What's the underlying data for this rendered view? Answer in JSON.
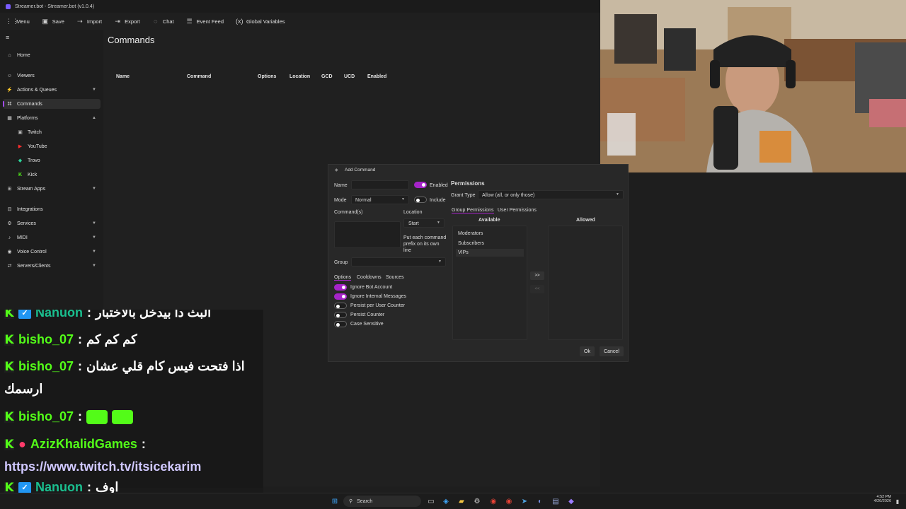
{
  "window": {
    "title": "Streamer.bot - Streamer.bot (v1.0.4)"
  },
  "toolbar": {
    "items": [
      {
        "label": "Menu",
        "icon": "grid-icon"
      },
      {
        "label": "Save",
        "icon": "save-icon"
      },
      {
        "label": "Import",
        "icon": "import-icon"
      },
      {
        "label": "Export",
        "icon": "export-icon"
      },
      {
        "label": "Chat",
        "icon": "chat-icon"
      },
      {
        "label": "Event Feed",
        "icon": "feed-icon"
      },
      {
        "label": "Global Variables",
        "icon": "variables-icon"
      }
    ]
  },
  "sidebar": {
    "items": [
      {
        "label": "Home",
        "icon": "home-icon"
      },
      {
        "label": "Viewers",
        "icon": "viewers-icon"
      },
      {
        "label": "Actions & Queues",
        "icon": "actions-icon",
        "expandable": true
      },
      {
        "label": "Commands",
        "icon": "commands-icon",
        "selected": true
      },
      {
        "label": "Platforms",
        "icon": "platforms-icon",
        "expanded": true
      },
      {
        "label": "Twitch",
        "icon": "twitch-icon",
        "sub": true
      },
      {
        "label": "YouTube",
        "icon": "youtube-icon",
        "sub": true
      },
      {
        "label": "Trovo",
        "icon": "trovo-icon",
        "sub": true
      },
      {
        "label": "Kick",
        "icon": "kick-icon",
        "sub": true
      },
      {
        "label": "Stream Apps",
        "icon": "stream-apps-icon",
        "expandable": true
      },
      {
        "label": "Integrations",
        "icon": "integrations-icon"
      },
      {
        "label": "Services",
        "icon": "services-icon",
        "expandable": true
      },
      {
        "label": "MIDI",
        "icon": "midi-icon",
        "expandable": true
      },
      {
        "label": "Voice Control",
        "icon": "voice-icon",
        "expandable": true
      },
      {
        "label": "Servers/Clients",
        "icon": "servers-icon",
        "expandable": true
      }
    ]
  },
  "main": {
    "title": "Commands",
    "columns": [
      "Name",
      "Command",
      "Options",
      "Location",
      "GCD",
      "UCD",
      "Enabled"
    ]
  },
  "dialog": {
    "title": "Add Command",
    "name_label": "Name",
    "name_value": "",
    "enabled_label": "Enabled",
    "enabled": true,
    "mode_label": "Mode",
    "mode_value": "Normal",
    "include_label": "Include",
    "include": false,
    "commands_label": "Command(s)",
    "commands_value": "",
    "location_label": "Location",
    "location_value": "Start",
    "location_hint": [
      "Put each command",
      "prefix on its own",
      "line"
    ],
    "group_label": "Group",
    "group_value": "",
    "tabs": [
      "Options",
      "Cooldowns",
      "Sources"
    ],
    "options": [
      {
        "label": "Ignore Bot Account",
        "on": true
      },
      {
        "label": "Ignore Internal Messages",
        "on": true
      },
      {
        "label": "Persist per User Counter",
        "on": false
      },
      {
        "label": "Persist Counter",
        "on": false
      },
      {
        "label": "Case Sensitive",
        "on": false
      }
    ],
    "permissions_title": "Permissions",
    "grant_type_label": "Grant Type",
    "grant_type_value": "Allow (all, or only those)",
    "perm_tabs": [
      "Group Permissions",
      "User Permissions"
    ],
    "available_label": "Available",
    "allowed_label": "Allowed",
    "available": [
      "Moderators",
      "Subscribers",
      "VIPs"
    ],
    "allowed": [],
    "add_btn": ">>",
    "remove_btn": "<<",
    "ok_label": "Ok",
    "cancel_label": "Cancel"
  },
  "chat": {
    "lines": [
      {
        "user": "Nanuon",
        "message": "البث دا بيدخل بالاختبار",
        "badge": "verified"
      },
      {
        "user": "bisho_07",
        "message": "كم كم كم"
      },
      {
        "user": "bisho_07",
        "message": "اذا فتحت فيس كام قلي عشان"
      },
      {
        "user": "",
        "message": "ارسمك"
      },
      {
        "user": "bisho_07",
        "message": ""
      },
      {
        "user": "AzizKhalidGames",
        "message": ""
      },
      {
        "user": "",
        "message": "https://www.twitch.tv/itsicekarim"
      },
      {
        "user": "Nanuon",
        "message": "اوف",
        "badge": "verified"
      }
    ]
  },
  "taskbar": {
    "search_label": "Search",
    "time": "4:52 PM",
    "date": "4/20/2026"
  },
  "colors": {
    "accent": "#a624c9",
    "kick_green": "#53fc18",
    "nanuon_teal": "#1abf8f"
  }
}
